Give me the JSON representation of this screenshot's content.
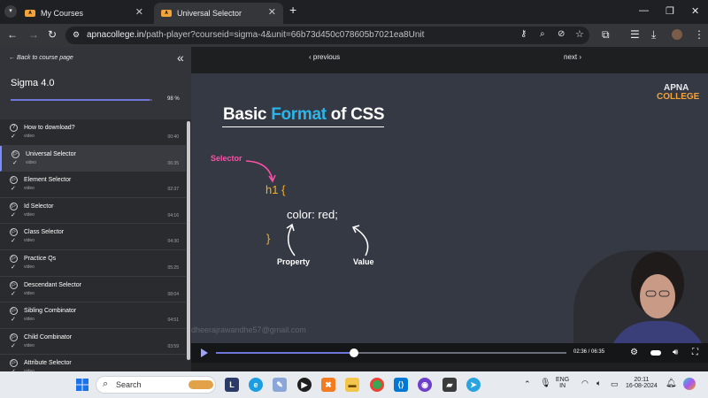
{
  "browser": {
    "tabs": [
      {
        "label": "My Courses",
        "active": false
      },
      {
        "label": "Universal Selector",
        "active": true
      }
    ],
    "new_tab": "+",
    "url_host": "apnacollege.in",
    "url_path": "/path-player?courseid=sigma-4&unit=66b73d450c078605b7021ea8Unit"
  },
  "sidebar": {
    "back_label": "← Back to course page",
    "collapse_glyph": "«",
    "course_title": "Sigma 4.0",
    "progress_text": "98 %",
    "progress_value": 0.98,
    "lessons": [
      {
        "title": "How to download?",
        "type": "video",
        "duration": "00:40",
        "icon": "?",
        "active": false
      },
      {
        "title": "Universal Selector",
        "type": "video",
        "duration": "06:35",
        "icon": "▷",
        "active": true
      },
      {
        "title": "Element Selector",
        "type": "video",
        "duration": "02:37",
        "icon": "▷",
        "active": false
      },
      {
        "title": "Id Selector",
        "type": "video",
        "duration": "04:16",
        "icon": "▷",
        "active": false
      },
      {
        "title": "Class Selector",
        "type": "video",
        "duration": "04:30",
        "icon": "▷",
        "active": false
      },
      {
        "title": "Practice Qs",
        "type": "video",
        "duration": "05:25",
        "icon": "▷",
        "active": false
      },
      {
        "title": "Descendant Selector",
        "type": "video",
        "duration": "08:04",
        "icon": "▷",
        "active": false
      },
      {
        "title": "Sibling Combinator",
        "type": "video",
        "duration": "04:51",
        "icon": "▷",
        "active": false
      },
      {
        "title": "Child Combinator",
        "type": "video",
        "duration": "03:59",
        "icon": "▷",
        "active": false
      },
      {
        "title": "Attribute Selector",
        "type": "video",
        "duration": "",
        "icon": "▷",
        "active": false
      }
    ]
  },
  "player": {
    "prev_label": "‹ previous",
    "next_label": "next ›",
    "slide": {
      "title_a": "Basic ",
      "title_b": "Format",
      "title_c": " of CSS",
      "logo_line1": "APNA",
      "logo_line2": "COLLEGE",
      "code_open": "h1 {",
      "code_prop": "color:  red;",
      "code_close": "}",
      "label_selector": "Selector",
      "label_property": "Property",
      "label_value": "Value",
      "watermark": "dheerajrawandhe57@gmail.com"
    },
    "time": "02:36 / 06:35",
    "played_fraction": 0.394
  },
  "taskbar": {
    "search_placeholder": "Search",
    "lang_line1": "ENG",
    "lang_line2": "IN",
    "clock_time": "20:11",
    "clock_date": "16-08-2024"
  },
  "colors": {
    "accent": "#6f76d8",
    "css_blue": "#2bb5ea",
    "brace_orange": "#f5b020",
    "selector_pink": "#ff4fa8"
  }
}
